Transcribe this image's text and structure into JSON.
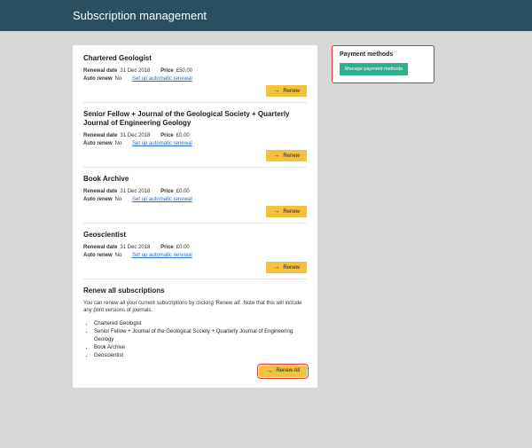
{
  "header": {
    "title": "Subscription management"
  },
  "labels": {
    "renewal_date": "Renewal date",
    "price": "Price",
    "auto_renew": "Auto renew",
    "setup_link": "Set up automatic renewal",
    "renew_btn": "Renew",
    "renew_all_btn": "Renew All"
  },
  "subscriptions": [
    {
      "title": "Chartered Geologist",
      "renewal_date": "31 Dec 2018",
      "price": "£50.00",
      "auto_renew": "No"
    },
    {
      "title": "Senior Fellow + Journal of the Geological Society + Quarterly Journal of Engineering Geology",
      "renewal_date": "31 Dec 2018",
      "price": "£0.00",
      "auto_renew": "No"
    },
    {
      "title": "Book Archive",
      "renewal_date": "31 Dec 2018",
      "price": "£0.00",
      "auto_renew": "No"
    },
    {
      "title": "Geoscientist",
      "renewal_date": "31 Dec 2018",
      "price": "£0.00",
      "auto_renew": "No"
    }
  ],
  "renew_all": {
    "title": "Renew all subscriptions",
    "text": "You can renew all your current subscriptions by clicking 'Renew all'. Note that this will include any print versions of journals.",
    "items": [
      "Chartered Geologist",
      "Senior Fellow + Journal of the Geological Society + Quarterly Journal of Engineering Geology",
      "Book Archive",
      "Geoscientist"
    ]
  },
  "sidebar": {
    "title": "Payment methods",
    "button": "Manage payment methods"
  }
}
